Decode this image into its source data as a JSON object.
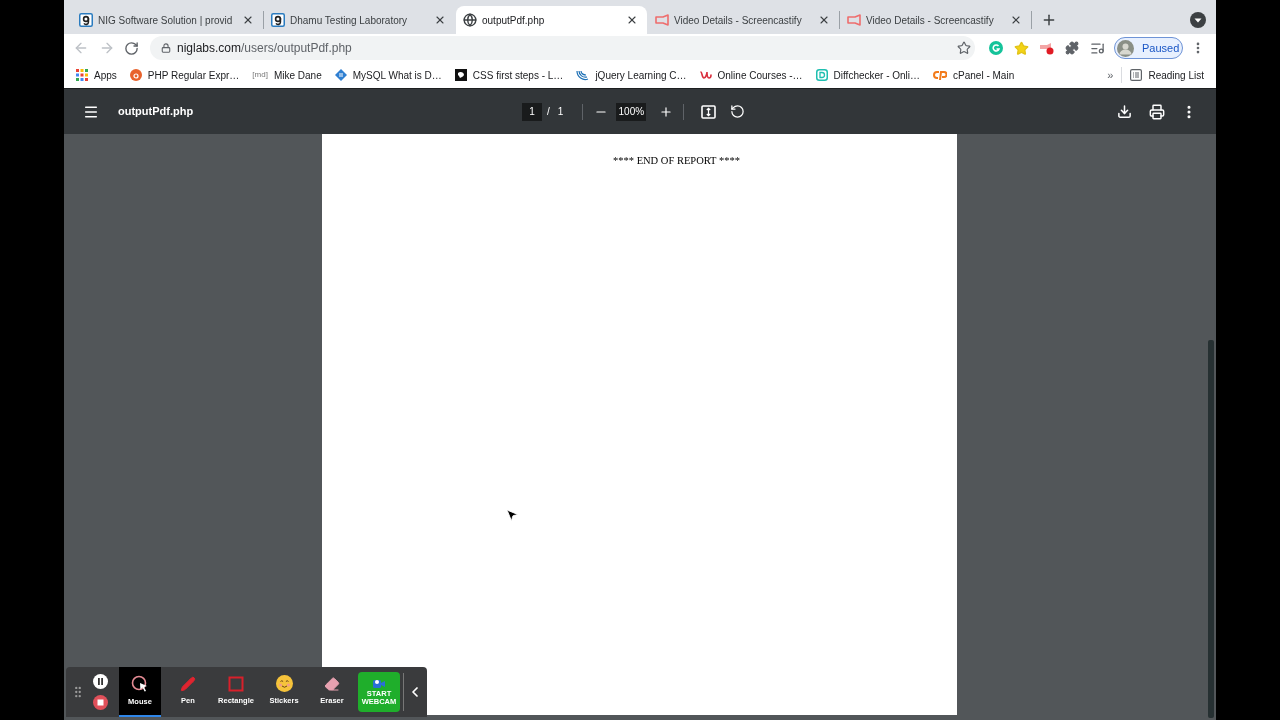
{
  "browser": {
    "tabs": [
      {
        "title": "NIG Software Solution | provid",
        "selected": false
      },
      {
        "title": "Dhamu Testing Laboratory",
        "selected": false
      },
      {
        "title": "outputPdf.php",
        "selected": true
      },
      {
        "title": "Video Details - Screencastify",
        "selected": false
      },
      {
        "title": "Video Details - Screencastify",
        "selected": false
      }
    ],
    "address_bar": {
      "host": "niglabs.com",
      "path": "/users/outputPdf.php"
    },
    "profile_button": "Paused",
    "bookmarks": [
      {
        "label": "Apps"
      },
      {
        "label": "PHP Regular Expr…"
      },
      {
        "favicon_text": "[md]",
        "label": "Mike Dane"
      },
      {
        "label": "MySQL What is D…"
      },
      {
        "label": "CSS first steps - L…"
      },
      {
        "label": "jQuery Learning C…"
      },
      {
        "label": "Online Courses -…"
      },
      {
        "label": "Diffchecker - Onli…"
      },
      {
        "label": "cPanel - Main"
      }
    ],
    "bookmarks_overflow": "»",
    "reading_list": "Reading List"
  },
  "pdf_viewer": {
    "file_name": "outputPdf.php",
    "page_input": "1",
    "page_separator": "/",
    "page_count": "1",
    "zoom": "100%",
    "document_text": "**** END OF REPORT ****"
  },
  "recorder_toolbar": {
    "tools": [
      {
        "label": "Mouse",
        "selected": true
      },
      {
        "label": "Pen",
        "selected": false
      },
      {
        "label": "Rectangle",
        "selected": false
      },
      {
        "label": "Stickers",
        "selected": false
      },
      {
        "label": "Eraser",
        "selected": false
      }
    ],
    "webcam_button": "START WEBCAM"
  }
}
